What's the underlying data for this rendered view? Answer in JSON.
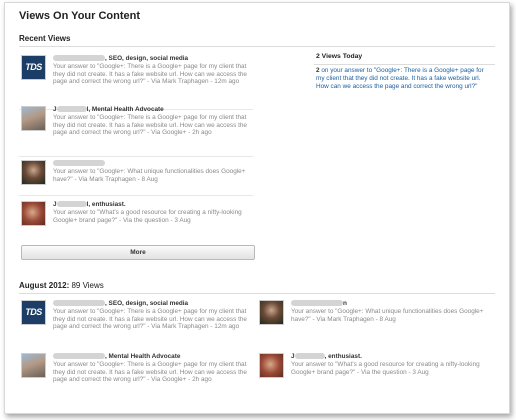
{
  "page_title": "Views On Your Content",
  "recent": {
    "title": "Recent Views",
    "items": [
      {
        "name_tail": ", SEO, design, social media",
        "snippet": "Your answer to \"Google+: There is a Google+ page for my client that they did not create.  It has a fake website url.  How can we access the page and correct the wrong url?\" - Via Mark Traphagen - 12m ago"
      },
      {
        "name_head": "J",
        "name_tail": "l, Mental Health Advocate",
        "snippet": "Your answer to \"Google+: There is a Google+ page for my client that they did not create.  It has a fake website url.  How can we access the page and correct the wrong url?\" - Via Google+ - 2h ago"
      },
      {
        "name_tail": "",
        "snippet": "Your answer to \"Google+: What unique functionalities does Google+ have?\" - Via Mark Traphagen - 8 Aug"
      },
      {
        "name_head": "J",
        "name_tail": "l, enthusiast.",
        "snippet": "Your answer to \"What's a good resource for creating a nifty-looking Google+ brand page?\" - Via the question - 3 Aug"
      }
    ],
    "more_label": "More"
  },
  "today": {
    "title": "2 Views Today",
    "count": "2",
    "text": " on your answer to \"Google+: There is a Google+ page for my client that they did not create.  It has a fake website url.  How can we access the page and correct the wrong url?\""
  },
  "month": {
    "label": "August 2012:",
    "views": "89 Views",
    "items": [
      {
        "name_tail": ", SEO, design, social media",
        "snippet": "Your answer to \"Google+: There is a Google+ page for my client that they did not create.  It has a fake website url.  How can we access the page and correct the wrong url?\" - Via Mark Traphagen - 12m ago"
      },
      {
        "name_tail": "n",
        "snippet": "Your answer to \"Google+: What unique functionalities does Google+ have?\" - Via Mark Traphagen - 8 Aug"
      },
      {
        "name_tail": ", Mental Health Advocate",
        "snippet": "Your answer to \"Google+: There is a Google+ page for my client that they did not create.  It has a fake website url.  How can we access the page and correct the wrong url?\" - Via Google+ - 2h ago"
      },
      {
        "name_head": "J",
        "name_tail": ", enthusiast.",
        "snippet": "Your answer to \"What's a good resource for creating a nifty-looking Google+ brand page?\" - Via the question - 3 Aug"
      }
    ]
  },
  "thumbs": [
    "tds-logo",
    "profile-photo",
    "profile-photo",
    "profile-photo"
  ],
  "thumb_label": "TDS",
  "colors": {
    "link": "#1a5fa0",
    "muted": "#8a8a8a",
    "rule": "#dcdcdc"
  }
}
